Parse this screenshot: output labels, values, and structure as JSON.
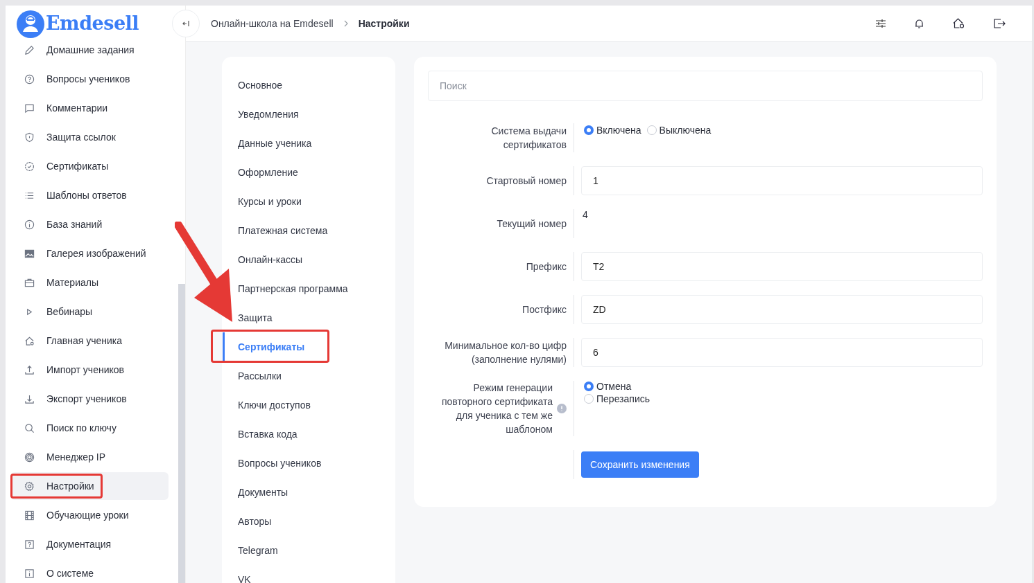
{
  "logo": {
    "text": "Emdesell"
  },
  "header": {
    "breadcrumbs": [
      {
        "label": "Онлайн-школа на Emdesell",
        "current": false
      },
      {
        "label": "Настройки",
        "current": true
      }
    ]
  },
  "sidebar": {
    "items": [
      {
        "label": "Домашние задания",
        "selected": false,
        "annotated": false
      },
      {
        "label": "Вопросы учеников",
        "selected": false,
        "annotated": false
      },
      {
        "label": "Комментарии",
        "selected": false,
        "annotated": false
      },
      {
        "label": "Защита ссылок",
        "selected": false,
        "annotated": false
      },
      {
        "label": "Сертификаты",
        "selected": false,
        "annotated": false
      },
      {
        "label": "Шаблоны ответов",
        "selected": false,
        "annotated": false
      },
      {
        "label": "База знаний",
        "selected": false,
        "annotated": false
      },
      {
        "label": "Галерея изображений",
        "selected": false,
        "annotated": false
      },
      {
        "label": "Материалы",
        "selected": false,
        "annotated": false
      },
      {
        "label": "Вебинары",
        "selected": false,
        "annotated": false
      },
      {
        "label": "Главная ученика",
        "selected": false,
        "annotated": false
      },
      {
        "label": "Импорт учеников",
        "selected": false,
        "annotated": false
      },
      {
        "label": "Экспорт учеников",
        "selected": false,
        "annotated": false
      },
      {
        "label": "Поиск по ключу",
        "selected": false,
        "annotated": false
      },
      {
        "label": "Менеджер IP",
        "selected": false,
        "annotated": false
      },
      {
        "label": "Настройки",
        "selected": true,
        "annotated": true
      },
      {
        "label": "Обучающие уроки",
        "selected": false,
        "annotated": false
      },
      {
        "label": "Документация",
        "selected": false,
        "annotated": false
      },
      {
        "label": "О системе",
        "selected": false,
        "annotated": false
      }
    ]
  },
  "settings_nav": {
    "items": [
      {
        "label": "Основное",
        "selected": false,
        "annotated": false
      },
      {
        "label": "Уведомления",
        "selected": false,
        "annotated": false
      },
      {
        "label": "Данные ученика",
        "selected": false,
        "annotated": false
      },
      {
        "label": "Оформление",
        "selected": false,
        "annotated": false
      },
      {
        "label": "Курсы и уроки",
        "selected": false,
        "annotated": false
      },
      {
        "label": "Платежная система",
        "selected": false,
        "annotated": false
      },
      {
        "label": "Онлайн-кассы",
        "selected": false,
        "annotated": false
      },
      {
        "label": "Партнерская программа",
        "selected": false,
        "annotated": false
      },
      {
        "label": "Защита",
        "selected": false,
        "annotated": false
      },
      {
        "label": "Сертификаты",
        "selected": true,
        "annotated": true
      },
      {
        "label": "Рассылки",
        "selected": false,
        "annotated": false
      },
      {
        "label": "Ключи доступов",
        "selected": false,
        "annotated": false
      },
      {
        "label": "Вставка кода",
        "selected": false,
        "annotated": false
      },
      {
        "label": "Вопросы учеников",
        "selected": false,
        "annotated": false
      },
      {
        "label": "Документы",
        "selected": false,
        "annotated": false
      },
      {
        "label": "Авторы",
        "selected": false,
        "annotated": false
      },
      {
        "label": "Telegram",
        "selected": false,
        "annotated": false
      },
      {
        "label": "VK",
        "selected": false,
        "annotated": false
      }
    ]
  },
  "form": {
    "search": {
      "placeholder": "Поиск"
    },
    "fields": [
      {
        "kind": "radio_inline",
        "label": "Система выдачи сертификатов",
        "options": [
          {
            "label": "Включена",
            "selected": true
          },
          {
            "label": "Выключена",
            "selected": false
          }
        ]
      },
      {
        "kind": "input",
        "label": "Стартовый номер",
        "value": "1"
      },
      {
        "kind": "text",
        "label": "Текущий номер",
        "value": "4"
      },
      {
        "kind": "input",
        "label": "Префикс",
        "value": "T2"
      },
      {
        "kind": "input",
        "label": "Постфикс",
        "value": "ZD"
      },
      {
        "kind": "input",
        "label": "Минимальное кол-во цифр (заполнение нулями)",
        "value": "6"
      },
      {
        "kind": "radio_stacked",
        "label": "Режим генерации повторного сертификата для ученика с тем же шаблоном",
        "hint": true,
        "options": [
          {
            "label": "Отмена",
            "selected": true
          },
          {
            "label": "Перезапись",
            "selected": false
          }
        ]
      }
    ],
    "save_button": "Сохранить изменения"
  }
}
